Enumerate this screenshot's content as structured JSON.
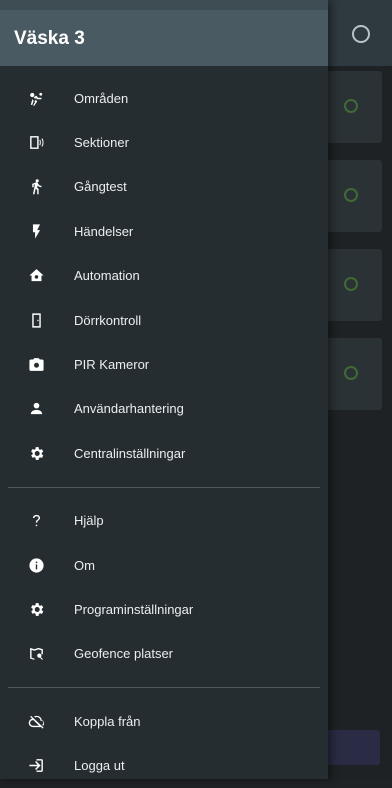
{
  "drawer": {
    "title": "Väska 3",
    "items": [
      {
        "label": "Områden",
        "icon": "areas-icon"
      },
      {
        "label": "Sektioner",
        "icon": "sections-icon"
      },
      {
        "label": "Gångtest",
        "icon": "walk-test-icon"
      },
      {
        "label": "Händelser",
        "icon": "events-icon"
      },
      {
        "label": "Automation",
        "icon": "automation-icon"
      },
      {
        "label": "Dörrkontroll",
        "icon": "door-icon"
      },
      {
        "label": "PIR Kameror",
        "icon": "camera-icon"
      },
      {
        "label": "Användarhantering",
        "icon": "user-icon"
      },
      {
        "label": "Centralinställningar",
        "icon": "gear-icon"
      }
    ],
    "items2": [
      {
        "label": "Hjälp",
        "icon": "help-icon"
      },
      {
        "label": "Om",
        "icon": "info-icon"
      },
      {
        "label": "Programinställningar",
        "icon": "gear-icon"
      },
      {
        "label": "Geofence platser",
        "icon": "map-icon"
      }
    ],
    "items3": [
      {
        "label": "Koppla från",
        "icon": "cloud-off-icon"
      },
      {
        "label": "Logga ut",
        "icon": "logout-icon"
      }
    ]
  },
  "colors": {
    "drawer_bg": "#262d31",
    "header_bg": "#4a5a62",
    "text": "#ffffff",
    "status_green": "#3f6a35"
  }
}
